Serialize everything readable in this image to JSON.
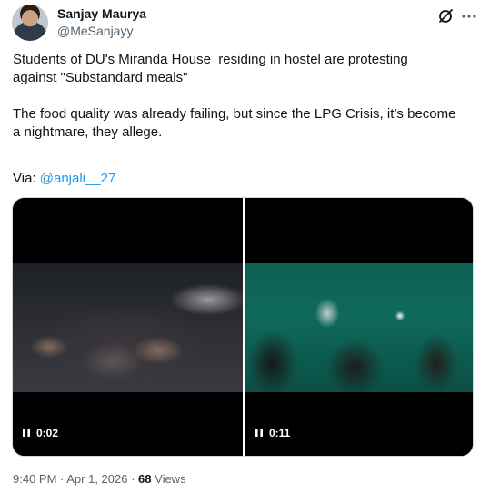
{
  "author": {
    "display_name": "Sanjay Maurya",
    "handle": "@MeSanjayy"
  },
  "icons": {
    "grok": "grok-icon",
    "more": "more-horizontal-icon",
    "pause": "pause-icon"
  },
  "tweet": {
    "paragraph_1": "Students of DU's Miranda House  residing in hostel are protesting\nagainst \"Substandard meals\"",
    "paragraph_2": "The food quality was already failing, but since the LPG Crisis, it’s become\na nightmare, they allege.",
    "via_label": "Via: ",
    "via_mention": "@anjali__27"
  },
  "media": {
    "videos": [
      {
        "time": "0:02"
      },
      {
        "time": "0:11"
      }
    ]
  },
  "meta": {
    "time": "9:40 PM",
    "separator": " · ",
    "date": "Apr 1, 2026",
    "views_separator": " · ",
    "views_count": "68",
    "views_label": " Views"
  },
  "colors": {
    "link": "#1d9bf0",
    "secondary_text": "#536471",
    "primary_text": "#0f1419"
  }
}
